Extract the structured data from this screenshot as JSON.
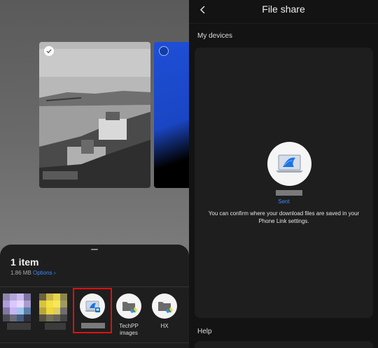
{
  "share_sheet": {
    "item_count": "1 item",
    "item_size": "1.86 MB",
    "options_label": "Options ›",
    "targets": [
      {
        "name": "phone-link-target",
        "label": "",
        "icon": "laptop-icon"
      },
      {
        "name": "techpp-images-target",
        "label": "TechPP images",
        "icon": "folder-drive-icon"
      },
      {
        "name": "hx-target",
        "label": "HX",
        "icon": "folder-drive-icon"
      }
    ]
  },
  "file_share": {
    "title": "File share",
    "my_devices": "My devices",
    "status": "Sent",
    "message": "You can confirm where your download files are saved in your Phone Link settings.",
    "help": "Help"
  },
  "colors": {
    "accent": "#3d8bfd",
    "highlight": "#e01010"
  }
}
